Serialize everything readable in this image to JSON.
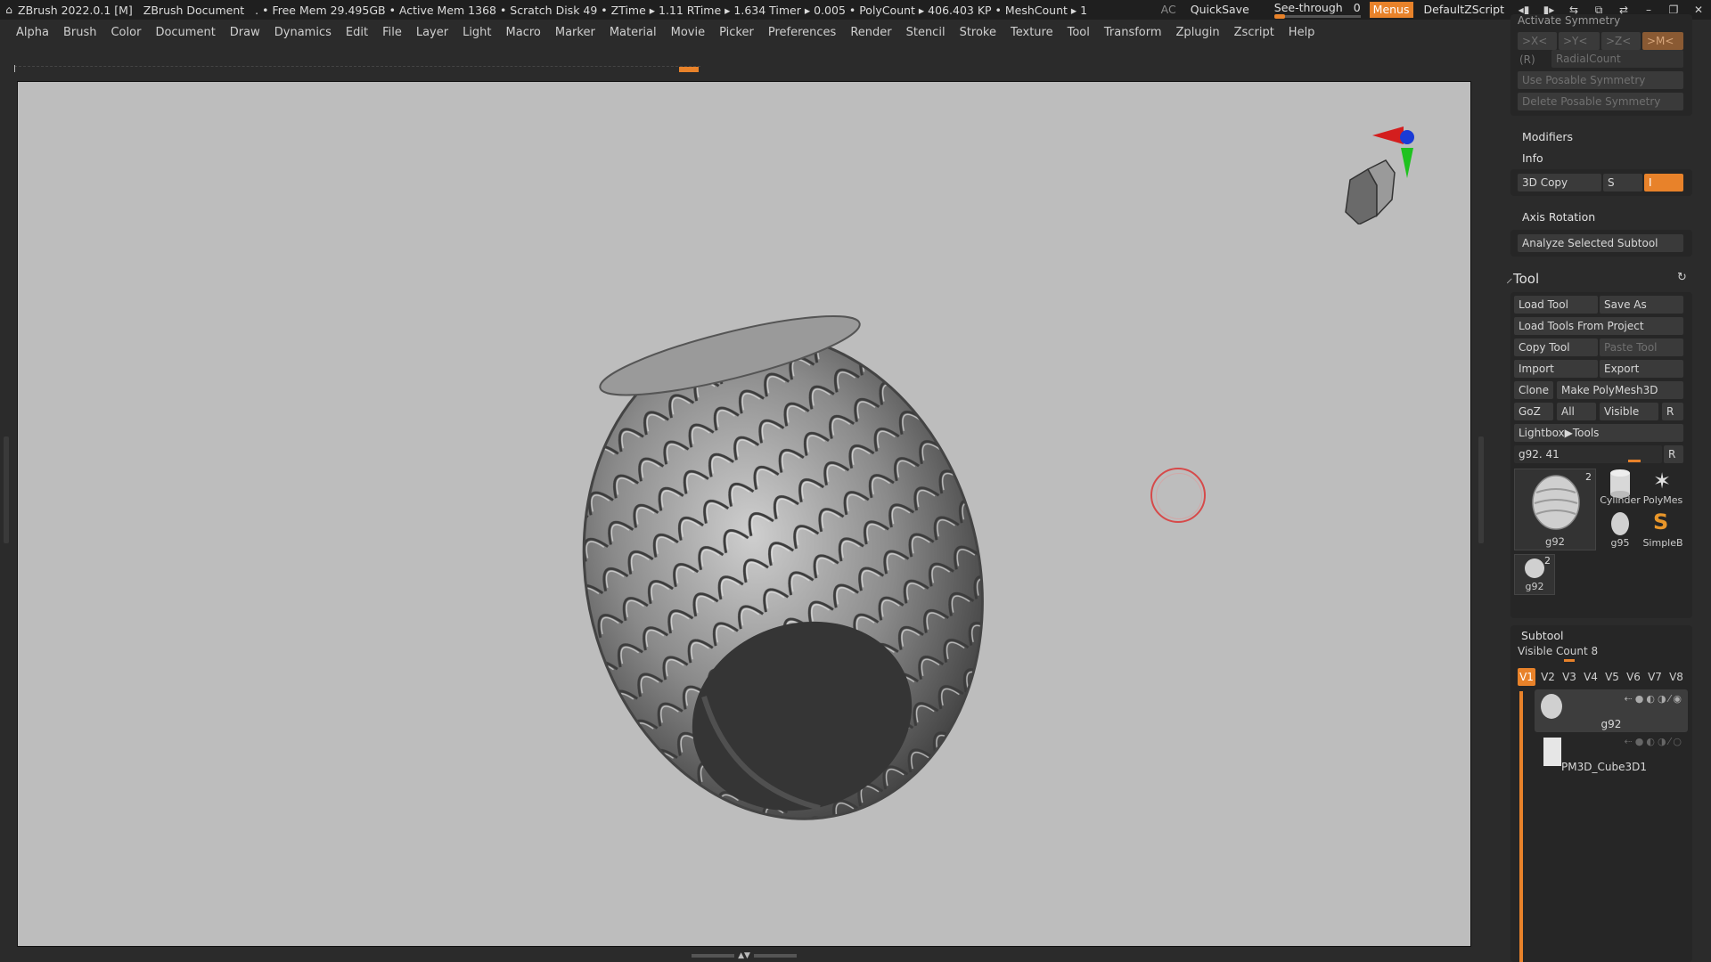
{
  "titlebar": {
    "app_title": "ZBrush 2022.0.1 [M]",
    "document": "ZBrush Document",
    "status": ". • Free Mem 29.495GB • Active Mem 1368 • Scratch Disk 49 • ZTime ▸ 1.11 RTime ▸ 1.634 Timer ▸ 0.005 • PolyCount ▸ 406.403 KP • MeshCount ▸ 1",
    "ac": "AC",
    "quicksave": "QuickSave",
    "see_through_label": "See-through",
    "see_through_value": "0",
    "menus": "Menus",
    "default_zscript": "DefaultZScript"
  },
  "menubar": {
    "items": [
      "Alpha",
      "Brush",
      "Color",
      "Document",
      "Draw",
      "Dynamics",
      "Edit",
      "File",
      "Layer",
      "Light",
      "Macro",
      "Marker",
      "Material",
      "Movie",
      "Picker",
      "Preferences",
      "Render",
      "Stencil",
      "Stroke",
      "Texture",
      "Tool",
      "Transform",
      "Zplugin",
      "Zscript",
      "Help"
    ]
  },
  "panel": {
    "top_cut_label": "Activate Symmetry",
    "sym_x": ">X<",
    "sym_y": ">Y<",
    "sym_z": ">Z<",
    "sym_m": ">M<",
    "r_label": "(R)",
    "radial_count": "RadialCount",
    "use_posable": "Use Posable Symmetry",
    "delete_posable": "Delete Posable Symmetry",
    "modifiers": "Modifiers",
    "info": "Info",
    "copy3d": "3D Copy",
    "copy3d_s": "S",
    "copy3d_i": "I",
    "axis_rotation": "Axis Rotation",
    "analyze": "Analyze Selected Subtool",
    "tool_title": "Tool",
    "load_tool": "Load Tool",
    "save_as": "Save As",
    "load_from_project": "Load Tools From Project",
    "copy_tool": "Copy Tool",
    "paste_tool": "Paste Tool",
    "import": "Import",
    "export": "Export",
    "clone": "Clone",
    "make_polymesh": "Make PolyMesh3D",
    "goz": "GoZ",
    "all": "All",
    "visible": "Visible",
    "r": "R",
    "lightbox_tools": "Lightbox▶Tools",
    "current_tool_value": "g92. 41",
    "thumbs": {
      "main_name": "g92",
      "main_count": "2",
      "cylinder": "Cylinder",
      "polymesh": "PolyMes",
      "g95": "g95",
      "simpleb": "SimpleB",
      "small_name": "g92",
      "small_count": "2"
    },
    "subtool_title": "Subtool",
    "visible_count": "Visible Count 8",
    "v_tabs": [
      "V1",
      "V2",
      "V3",
      "V4",
      "V5",
      "V6",
      "V7",
      "V8"
    ],
    "subtools": [
      {
        "name": "g92"
      },
      {
        "name": "PM3D_Cube3D1"
      }
    ]
  },
  "colors": {
    "accent": "#e8822a",
    "viewport_bg": "#bdbdbd",
    "ui_bg": "#2b2b2b"
  }
}
